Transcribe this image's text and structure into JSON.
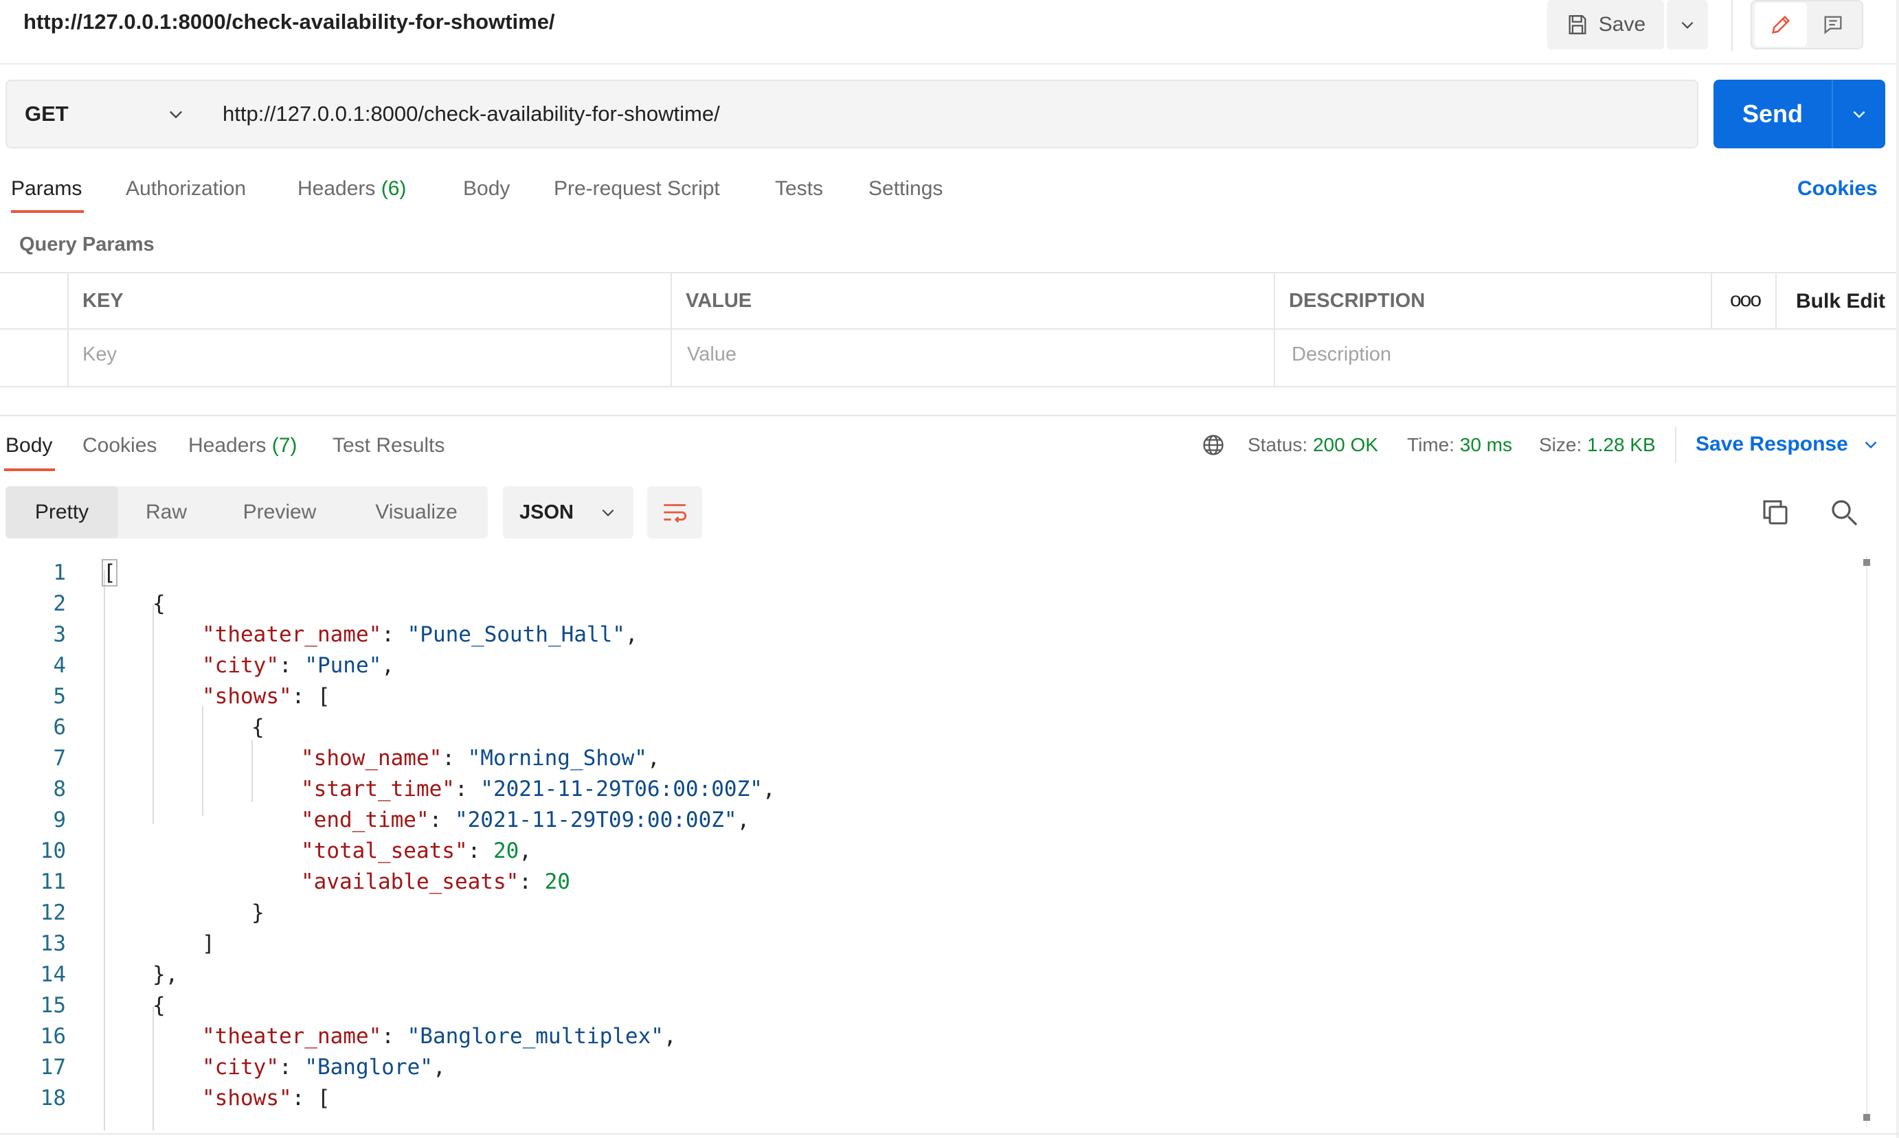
{
  "header": {
    "url_title": "http://127.0.0.1:8000/check-availability-for-showtime/",
    "save_label": "Save"
  },
  "request": {
    "method": "GET",
    "url": "http://127.0.0.1:8000/check-availability-for-showtime/",
    "send_label": "Send"
  },
  "request_tabs": {
    "params": "Params",
    "authorization": "Authorization",
    "headers": "Headers",
    "headers_count": "(6)",
    "body": "Body",
    "prerequest": "Pre-request Script",
    "tests": "Tests",
    "settings": "Settings",
    "cookies": "Cookies"
  },
  "query_params": {
    "title": "Query Params",
    "columns": {
      "key": "KEY",
      "value": "VALUE",
      "description": "DESCRIPTION"
    },
    "more": "ooo",
    "bulk_edit": "Bulk Edit",
    "placeholders": {
      "key": "Key",
      "value": "Value",
      "description": "Description"
    }
  },
  "response_tabs": {
    "body": "Body",
    "cookies": "Cookies",
    "headers": "Headers",
    "headers_count": "(7)",
    "test_results": "Test Results"
  },
  "response_status": {
    "status_label": "Status:",
    "status_value": "200 OK",
    "time_label": "Time:",
    "time_value": "30 ms",
    "size_label": "Size:",
    "size_value": "1.28 KB",
    "save_response": "Save Response"
  },
  "view_options": {
    "pretty": "Pretty",
    "raw": "Raw",
    "preview": "Preview",
    "visualize": "Visualize",
    "format": "JSON"
  },
  "code_lines": [
    {
      "n": "1",
      "parts": [
        [
          "p",
          "["
        ]
      ]
    },
    {
      "n": "2",
      "parts": [
        [
          "p",
          "{"
        ]
      ]
    },
    {
      "n": "3",
      "parts": [
        [
          "k",
          "\"theater_name\""
        ],
        [
          "p",
          ": "
        ],
        [
          "s",
          "\"Pune_South_Hall\""
        ],
        [
          "p",
          ","
        ]
      ]
    },
    {
      "n": "4",
      "parts": [
        [
          "k",
          "\"city\""
        ],
        [
          "p",
          ": "
        ],
        [
          "s",
          "\"Pune\""
        ],
        [
          "p",
          ","
        ]
      ]
    },
    {
      "n": "5",
      "parts": [
        [
          "k",
          "\"shows\""
        ],
        [
          "p",
          ": ["
        ]
      ]
    },
    {
      "n": "6",
      "parts": [
        [
          "p",
          "{"
        ]
      ]
    },
    {
      "n": "7",
      "parts": [
        [
          "k",
          "\"show_name\""
        ],
        [
          "p",
          ": "
        ],
        [
          "s",
          "\"Morning_Show\""
        ],
        [
          "p",
          ","
        ]
      ]
    },
    {
      "n": "8",
      "parts": [
        [
          "k",
          "\"start_time\""
        ],
        [
          "p",
          ": "
        ],
        [
          "s",
          "\"2021-11-29T06:00:00Z\""
        ],
        [
          "p",
          ","
        ]
      ]
    },
    {
      "n": "9",
      "parts": [
        [
          "k",
          "\"end_time\""
        ],
        [
          "p",
          ": "
        ],
        [
          "s",
          "\"2021-11-29T09:00:00Z\""
        ],
        [
          "p",
          ","
        ]
      ]
    },
    {
      "n": "10",
      "parts": [
        [
          "k",
          "\"total_seats\""
        ],
        [
          "p",
          ": "
        ],
        [
          "n",
          "20"
        ],
        [
          "p",
          ","
        ]
      ]
    },
    {
      "n": "11",
      "parts": [
        [
          "k",
          "\"available_seats\""
        ],
        [
          "p",
          ": "
        ],
        [
          "n",
          "20"
        ]
      ]
    },
    {
      "n": "12",
      "parts": [
        [
          "p",
          "}"
        ]
      ]
    },
    {
      "n": "13",
      "parts": [
        [
          "p",
          "]"
        ]
      ]
    },
    {
      "n": "14",
      "parts": [
        [
          "p",
          "},"
        ]
      ]
    },
    {
      "n": "15",
      "parts": [
        [
          "p",
          "{"
        ]
      ]
    },
    {
      "n": "16",
      "parts": [
        [
          "k",
          "\"theater_name\""
        ],
        [
          "p",
          ": "
        ],
        [
          "s",
          "\"Banglore_multiplex\""
        ],
        [
          "p",
          ","
        ]
      ]
    },
    {
      "n": "17",
      "parts": [
        [
          "k",
          "\"city\""
        ],
        [
          "p",
          ": "
        ],
        [
          "s",
          "\"Banglore\""
        ],
        [
          "p",
          ","
        ]
      ]
    },
    {
      "n": "18",
      "parts": [
        [
          "k",
          "\"shows\""
        ],
        [
          "p",
          ": ["
        ]
      ]
    }
  ],
  "colors": {
    "accent": "#0a6cdf",
    "tab_underline": "#e8583b",
    "success": "#0c8a2e",
    "json_key": "#a31515",
    "json_string": "#0d4a8c",
    "json_number": "#0b8c3c"
  },
  "icons": {
    "save": "save-disk-icon",
    "edit": "pencil-icon",
    "comment": "comment-icon",
    "globe": "globe-icon",
    "wrap": "wrap-lines-icon",
    "copy": "copy-icon",
    "search": "search-icon"
  }
}
